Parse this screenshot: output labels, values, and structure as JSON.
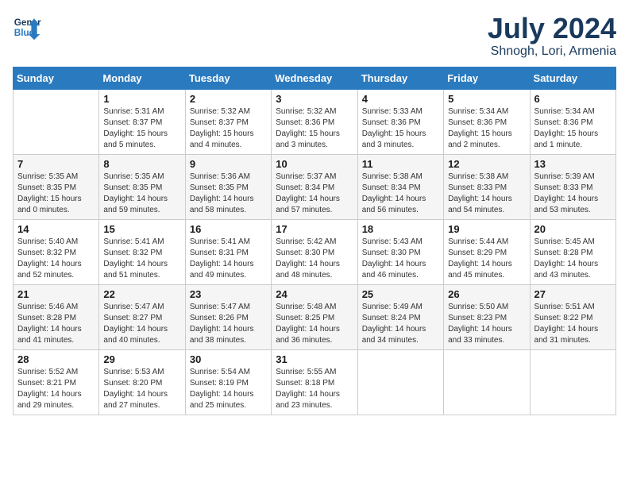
{
  "header": {
    "logo_line1": "General",
    "logo_line2": "Blue",
    "month_title": "July 2024",
    "location": "Shnogh, Lori, Armenia"
  },
  "weekdays": [
    "Sunday",
    "Monday",
    "Tuesday",
    "Wednesday",
    "Thursday",
    "Friday",
    "Saturday"
  ],
  "weeks": [
    [
      {
        "day": "",
        "info": ""
      },
      {
        "day": "1",
        "info": "Sunrise: 5:31 AM\nSunset: 8:37 PM\nDaylight: 15 hours\nand 5 minutes."
      },
      {
        "day": "2",
        "info": "Sunrise: 5:32 AM\nSunset: 8:37 PM\nDaylight: 15 hours\nand 4 minutes."
      },
      {
        "day": "3",
        "info": "Sunrise: 5:32 AM\nSunset: 8:36 PM\nDaylight: 15 hours\nand 3 minutes."
      },
      {
        "day": "4",
        "info": "Sunrise: 5:33 AM\nSunset: 8:36 PM\nDaylight: 15 hours\nand 3 minutes."
      },
      {
        "day": "5",
        "info": "Sunrise: 5:34 AM\nSunset: 8:36 PM\nDaylight: 15 hours\nand 2 minutes."
      },
      {
        "day": "6",
        "info": "Sunrise: 5:34 AM\nSunset: 8:36 PM\nDaylight: 15 hours\nand 1 minute."
      }
    ],
    [
      {
        "day": "7",
        "info": "Sunrise: 5:35 AM\nSunset: 8:35 PM\nDaylight: 15 hours\nand 0 minutes."
      },
      {
        "day": "8",
        "info": "Sunrise: 5:35 AM\nSunset: 8:35 PM\nDaylight: 14 hours\nand 59 minutes."
      },
      {
        "day": "9",
        "info": "Sunrise: 5:36 AM\nSunset: 8:35 PM\nDaylight: 14 hours\nand 58 minutes."
      },
      {
        "day": "10",
        "info": "Sunrise: 5:37 AM\nSunset: 8:34 PM\nDaylight: 14 hours\nand 57 minutes."
      },
      {
        "day": "11",
        "info": "Sunrise: 5:38 AM\nSunset: 8:34 PM\nDaylight: 14 hours\nand 56 minutes."
      },
      {
        "day": "12",
        "info": "Sunrise: 5:38 AM\nSunset: 8:33 PM\nDaylight: 14 hours\nand 54 minutes."
      },
      {
        "day": "13",
        "info": "Sunrise: 5:39 AM\nSunset: 8:33 PM\nDaylight: 14 hours\nand 53 minutes."
      }
    ],
    [
      {
        "day": "14",
        "info": "Sunrise: 5:40 AM\nSunset: 8:32 PM\nDaylight: 14 hours\nand 52 minutes."
      },
      {
        "day": "15",
        "info": "Sunrise: 5:41 AM\nSunset: 8:32 PM\nDaylight: 14 hours\nand 51 minutes."
      },
      {
        "day": "16",
        "info": "Sunrise: 5:41 AM\nSunset: 8:31 PM\nDaylight: 14 hours\nand 49 minutes."
      },
      {
        "day": "17",
        "info": "Sunrise: 5:42 AM\nSunset: 8:30 PM\nDaylight: 14 hours\nand 48 minutes."
      },
      {
        "day": "18",
        "info": "Sunrise: 5:43 AM\nSunset: 8:30 PM\nDaylight: 14 hours\nand 46 minutes."
      },
      {
        "day": "19",
        "info": "Sunrise: 5:44 AM\nSunset: 8:29 PM\nDaylight: 14 hours\nand 45 minutes."
      },
      {
        "day": "20",
        "info": "Sunrise: 5:45 AM\nSunset: 8:28 PM\nDaylight: 14 hours\nand 43 minutes."
      }
    ],
    [
      {
        "day": "21",
        "info": "Sunrise: 5:46 AM\nSunset: 8:28 PM\nDaylight: 14 hours\nand 41 minutes."
      },
      {
        "day": "22",
        "info": "Sunrise: 5:47 AM\nSunset: 8:27 PM\nDaylight: 14 hours\nand 40 minutes."
      },
      {
        "day": "23",
        "info": "Sunrise: 5:47 AM\nSunset: 8:26 PM\nDaylight: 14 hours\nand 38 minutes."
      },
      {
        "day": "24",
        "info": "Sunrise: 5:48 AM\nSunset: 8:25 PM\nDaylight: 14 hours\nand 36 minutes."
      },
      {
        "day": "25",
        "info": "Sunrise: 5:49 AM\nSunset: 8:24 PM\nDaylight: 14 hours\nand 34 minutes."
      },
      {
        "day": "26",
        "info": "Sunrise: 5:50 AM\nSunset: 8:23 PM\nDaylight: 14 hours\nand 33 minutes."
      },
      {
        "day": "27",
        "info": "Sunrise: 5:51 AM\nSunset: 8:22 PM\nDaylight: 14 hours\nand 31 minutes."
      }
    ],
    [
      {
        "day": "28",
        "info": "Sunrise: 5:52 AM\nSunset: 8:21 PM\nDaylight: 14 hours\nand 29 minutes."
      },
      {
        "day": "29",
        "info": "Sunrise: 5:53 AM\nSunset: 8:20 PM\nDaylight: 14 hours\nand 27 minutes."
      },
      {
        "day": "30",
        "info": "Sunrise: 5:54 AM\nSunset: 8:19 PM\nDaylight: 14 hours\nand 25 minutes."
      },
      {
        "day": "31",
        "info": "Sunrise: 5:55 AM\nSunset: 8:18 PM\nDaylight: 14 hours\nand 23 minutes."
      },
      {
        "day": "",
        "info": ""
      },
      {
        "day": "",
        "info": ""
      },
      {
        "day": "",
        "info": ""
      }
    ]
  ]
}
